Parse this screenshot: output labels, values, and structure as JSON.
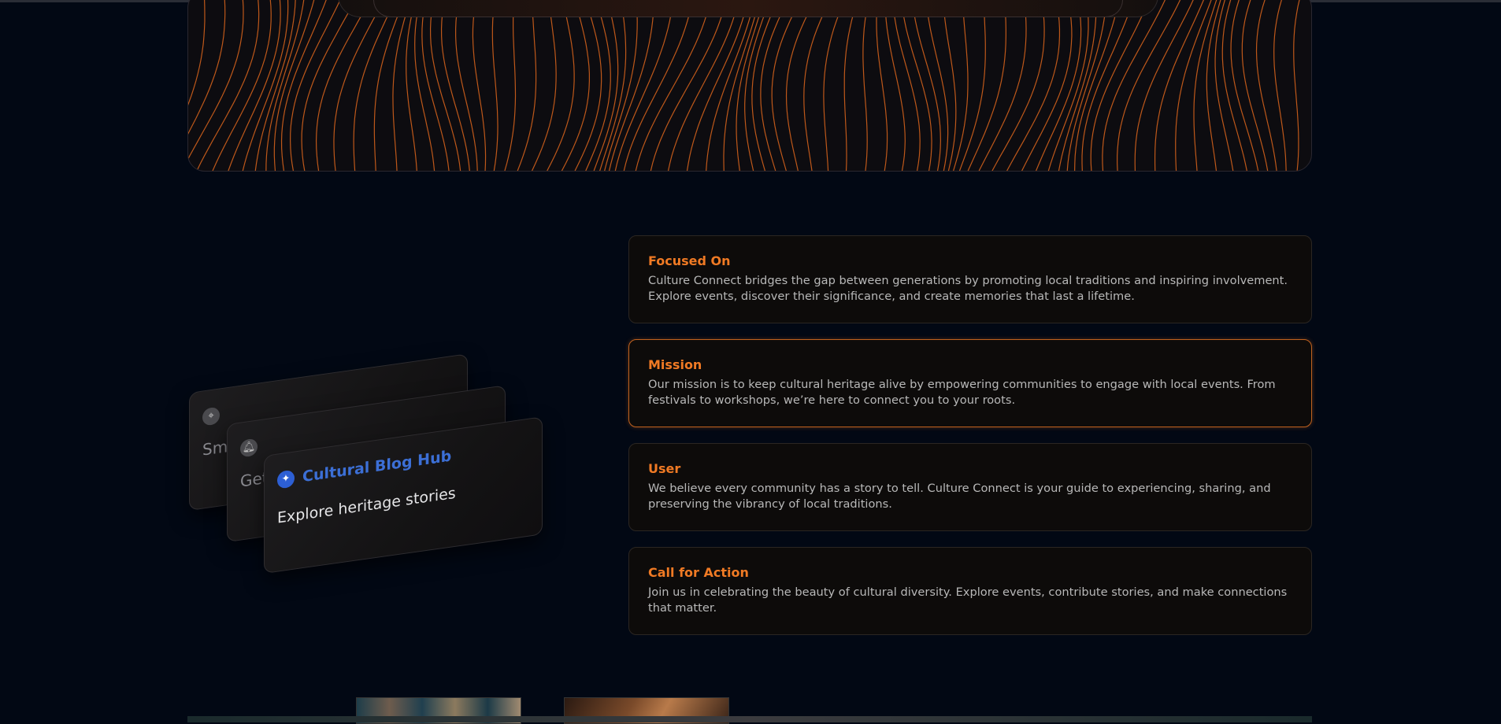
{
  "stack": {
    "card1_sub": "Sm",
    "card2_sub": "Get",
    "card3_title": "Cultural Blog Hub",
    "card3_sub": "Explore heritage stories"
  },
  "info": [
    {
      "title": "Focused On",
      "text": "Culture Connect bridges the gap between generations by promoting local traditions and inspiring involvement. Explore events, discover their significance, and create memories that last a lifetime."
    },
    {
      "title": "Mission",
      "text": "Our mission is to keep cultural heritage alive by empowering communities to engage with local events. From festivals to workshops, we’re here to connect you to your roots."
    },
    {
      "title": "User",
      "text": "We believe every community has a story to tell. Culture Connect is your guide to experiencing, sharing, and preserving the vibrancy of local traditions."
    },
    {
      "title": "Call for Action",
      "text": "Join us in celebrating the beauty of cultural diversity. Explore events, contribute stories, and make connections that matter."
    }
  ],
  "icons": {
    "card1": "target-icon",
    "card2": "bell-icon",
    "card3": "sparkle-icon"
  },
  "colors": {
    "accent": "#f07a24",
    "active_border": "#c0621f",
    "blog_blue": "#3c6fd6",
    "background": "#020814"
  }
}
